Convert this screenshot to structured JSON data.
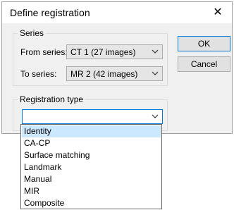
{
  "window": {
    "title": "Define registration",
    "close_glyph": "✕"
  },
  "series_group": {
    "title": "Series",
    "from_label": "From series:",
    "from_value": "CT 1 (27 images)",
    "to_label": "To series:",
    "to_value": "MR 2 (42 images)"
  },
  "buttons": {
    "ok": "OK",
    "cancel": "Cancel"
  },
  "registration_group": {
    "title": "Registration type",
    "selected_value": ""
  },
  "registration_options": [
    "Identity",
    "CA-CP",
    "Surface matching",
    "Landmark",
    "Manual",
    "MIR",
    "Composite"
  ],
  "highlighted_option": "Identity",
  "icons": {
    "combo_arrow": "chevron-down-icon",
    "close": "close-icon"
  },
  "colors": {
    "focus_border": "#0078d7",
    "highlight": "#cce8ff",
    "dialog_bg": "#f0f0f0"
  }
}
